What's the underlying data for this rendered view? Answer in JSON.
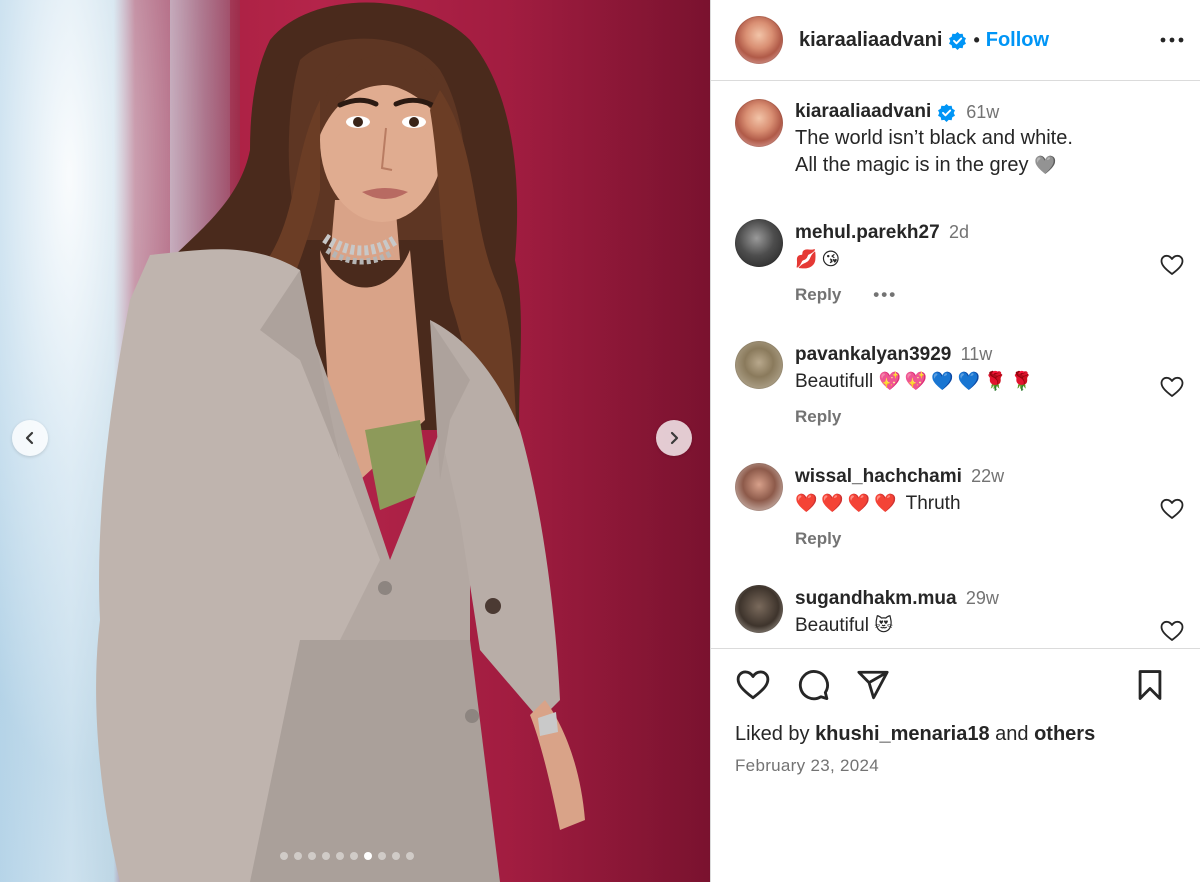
{
  "post": {
    "username": "kiaraaliaadvani",
    "follow_label": "Follow",
    "separator": "•",
    "caption": {
      "username": "kiaraaliaadvani",
      "time": "61w",
      "line1": "The world isn’t black and white.",
      "line2": "All the magic is in the grey",
      "emoji": "🩶"
    },
    "carousel": {
      "slide_count": 10,
      "active_index": 6
    }
  },
  "comments": [
    {
      "username": "mehul.parekh27",
      "time": "2d",
      "text": "",
      "emoji": "💋😘",
      "reply_label": "Reply",
      "more_label": "•••"
    },
    {
      "username": "pavankalyan3929",
      "time": "11w",
      "text": "Beautifull ",
      "emoji": "💖💖💙💙🌹🌹",
      "reply_label": "Reply"
    },
    {
      "username": "wissal_hachchami",
      "time": "22w",
      "text": " Thruth",
      "emoji": "❤️❤️❤️❤️",
      "reply_label": "Reply"
    },
    {
      "username": "sugandhakm.mua",
      "time": "29w",
      "text": "Beautiful ",
      "emoji": "😻"
    }
  ],
  "footer": {
    "liked_by_prefix": "Liked by ",
    "liked_by_user": "khushi_menaria18",
    "liked_by_middle": " and ",
    "liked_by_suffix": "others",
    "date": "February 23, 2024"
  },
  "colors": {
    "accent": "#0095f6",
    "text": "#262626",
    "muted": "#737373",
    "border": "#dbdbdb",
    "backdrop": "#a6203f"
  },
  "icons": {
    "like": "heart-icon",
    "comment": "comment-icon",
    "share": "send-icon",
    "save": "bookmark-icon",
    "more": "more-horizontal-icon",
    "verified": "verified-badge-icon",
    "prev": "chevron-left-icon",
    "next": "chevron-right-icon"
  }
}
